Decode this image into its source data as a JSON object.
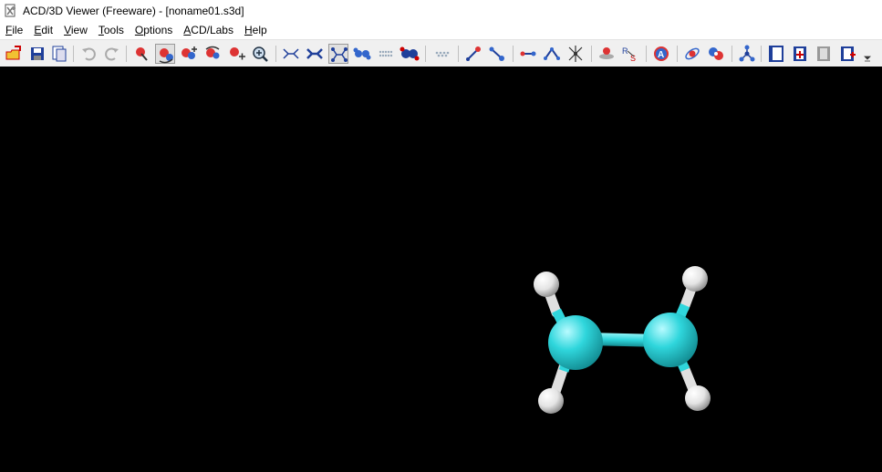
{
  "window": {
    "title": "ACD/3D Viewer (Freeware) - [noname01.s3d]",
    "app_icon": "acd-viewer-icon"
  },
  "menu": {
    "items": [
      {
        "label": "File",
        "hotkey": "F",
        "rest": "ile"
      },
      {
        "label": "Edit",
        "hotkey": "E",
        "rest": "dit"
      },
      {
        "label": "View",
        "hotkey": "V",
        "rest": "iew"
      },
      {
        "label": "Tools",
        "hotkey": "T",
        "rest": "ools"
      },
      {
        "label": "Options",
        "hotkey": "O",
        "rest": "ptions"
      },
      {
        "label": "ACD/Labs",
        "hotkey": "A",
        "rest": "CD/Labs"
      },
      {
        "label": "Help",
        "hotkey": "H",
        "rest": "elp"
      }
    ]
  },
  "toolbar": {
    "buttons": [
      "open-icon",
      "save-icon",
      "copy-icon",
      "undo-icon",
      "redo-icon",
      "select-atom-icon",
      "rotate-icon",
      "move-icon",
      "rotate-z-icon",
      "translate-icon",
      "zoom-icon",
      "wire-model-icon",
      "stick-model-icon",
      "ball-stick-icon",
      "spacefill-icon",
      "dots-icon",
      "cpk-icon",
      "surface-icon",
      "measure-distance-icon",
      "measure-angle-icon",
      "bond-length-icon",
      "bond-angle-icon",
      "torsion-icon",
      "optimize-icon",
      "rs-label-icon",
      "atom-label-icon",
      "orbital-icon",
      "dipole-icon",
      "molecule-icon",
      "film-icon",
      "film-add-icon",
      "film-strip-icon",
      "film-play-icon"
    ]
  },
  "molecule": {
    "name": "ethylene",
    "carbon_color": "#2fd6dc",
    "hydrogen_color": "#ececec",
    "bond_color": "#2fd6dc",
    "background_color": "#000000"
  }
}
